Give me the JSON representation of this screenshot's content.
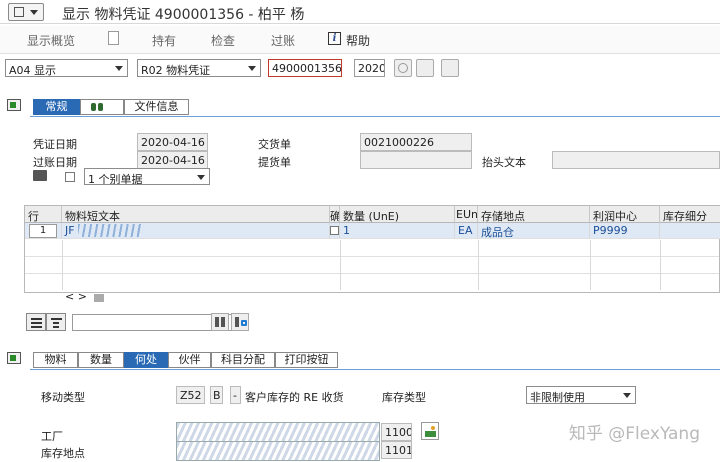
{
  "window": {
    "title": "显示 物料凭证 4900001356 - 柏平 杨"
  },
  "toolbar": {
    "overview": "显示概览",
    "hold": "持有",
    "check": "检查",
    "post": "过账",
    "help": "帮助"
  },
  "selection": {
    "action_value": "A04 显示",
    "reference_value": "R02 物料凭证",
    "doc_number": "4900001356",
    "doc_year": "2020"
  },
  "header_tabs": [
    "常规",
    "文件信息"
  ],
  "header": {
    "doc_date_label": "凭证日期",
    "doc_date": "2020-04-16",
    "post_date_label": "过账日期",
    "post_date": "2020-04-16",
    "delivery_note_label": "交货单",
    "delivery_note": "0021000226",
    "bill_lading_label": "提货单",
    "bill_lading": "",
    "header_text_label": "抬头文本",
    "header_text": "",
    "print_option": "1 个别单据"
  },
  "grid": {
    "columns": [
      "行",
      "物料短文本",
      "确",
      "数量 (UnE)",
      "EUn",
      "存储地点",
      "利润中心",
      "库存细分"
    ],
    "rows": [
      {
        "line": "1",
        "material_text": "JF",
        "ok": "",
        "qty": "1",
        "unit": "EA",
        "storage": "成品仓",
        "profit_center": "P9999",
        "stock_seg": ""
      }
    ],
    "scroll_nav": "< >"
  },
  "item_tabs": [
    "物料",
    "数量",
    "何处",
    "伙伴",
    "科目分配",
    "打印按钮"
  ],
  "item": {
    "movement_type_label": "移动类型",
    "movement_type": "Z52",
    "movement_indicator": "B",
    "movement_dash": "-",
    "movement_text": "客户库存的 RE 收货",
    "stock_type_label": "库存类型",
    "stock_type": "非限制使用",
    "plant_label": "工厂",
    "plant": "1100",
    "storage_label": "库存地点",
    "storage": "1101"
  },
  "watermark": "知乎 @FlexYang"
}
